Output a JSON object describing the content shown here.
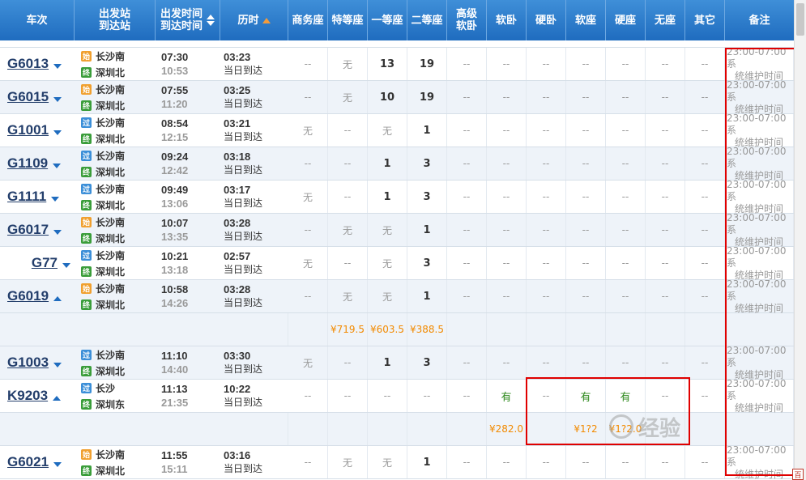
{
  "header": {
    "train_no": "车次",
    "dep_station": "出发站",
    "arr_station": "到达站",
    "dep_time": "出发时间",
    "arr_time": "到达时间",
    "duration": "历时",
    "business": "商务座",
    "special": "特等座",
    "first": "一等座",
    "second": "二等座",
    "adv_soft_1": "高级",
    "adv_soft_2": "软卧",
    "soft_sleeper": "软卧",
    "hard_sleeper": "硬卧",
    "soft_seat": "软座",
    "hard_seat": "硬座",
    "no_seat": "无座",
    "other": "其它",
    "remark": "备注"
  },
  "top_partial": {
    "left": "到达站",
    "mid": "到达时间",
    "right": "当日到达"
  },
  "rows": [
    {
      "train": "G6013",
      "dir": "down",
      "from_badge": "始",
      "from_type": "start",
      "from": "长沙南",
      "to_badge": "终",
      "to_type": "end",
      "to": "深圳北",
      "dep": "07:30",
      "arr": "10:53",
      "dur": "03:23",
      "day": "当日到达",
      "seats": [
        "--",
        "无",
        "13",
        "19",
        "--",
        "--",
        "--",
        "--",
        "--",
        "--",
        "--"
      ],
      "note1": "23:00-07:00系",
      "note2": "统维护时间"
    },
    {
      "train": "G6015",
      "dir": "down",
      "from_badge": "始",
      "from_type": "start",
      "from": "长沙南",
      "to_badge": "终",
      "to_type": "end",
      "to": "深圳北",
      "dep": "07:55",
      "arr": "11:20",
      "dur": "03:25",
      "day": "当日到达",
      "seats": [
        "--",
        "无",
        "10",
        "19",
        "--",
        "--",
        "--",
        "--",
        "--",
        "--",
        "--"
      ],
      "note1": "23:00-07:00系",
      "note2": "统维护时间"
    },
    {
      "train": "G1001",
      "dir": "down",
      "from_badge": "过",
      "from_type": "pass",
      "from": "长沙南",
      "to_badge": "终",
      "to_type": "end",
      "to": "深圳北",
      "dep": "08:54",
      "arr": "12:15",
      "dur": "03:21",
      "day": "当日到达",
      "seats": [
        "无",
        "--",
        "无",
        "1",
        "--",
        "--",
        "--",
        "--",
        "--",
        "--",
        "--"
      ],
      "note1": "23:00-07:00系",
      "note2": "统维护时间"
    },
    {
      "train": "G1109",
      "dir": "down",
      "from_badge": "过",
      "from_type": "pass",
      "from": "长沙南",
      "to_badge": "终",
      "to_type": "end",
      "to": "深圳北",
      "dep": "09:24",
      "arr": "12:42",
      "dur": "03:18",
      "day": "当日到达",
      "seats": [
        "--",
        "--",
        "1",
        "3",
        "--",
        "--",
        "--",
        "--",
        "--",
        "--",
        "--"
      ],
      "note1": "23:00-07:00系",
      "note2": "统维护时间"
    },
    {
      "train": "G1111",
      "dir": "down",
      "from_badge": "过",
      "from_type": "pass",
      "from": "长沙南",
      "to_badge": "终",
      "to_type": "end",
      "to": "深圳北",
      "dep": "09:49",
      "arr": "13:06",
      "dur": "03:17",
      "day": "当日到达",
      "seats": [
        "无",
        "--",
        "1",
        "3",
        "--",
        "--",
        "--",
        "--",
        "--",
        "--",
        "--"
      ],
      "note1": "23:00-07:00系",
      "note2": "统维护时间"
    },
    {
      "train": "G6017",
      "dir": "down",
      "from_badge": "始",
      "from_type": "start",
      "from": "长沙南",
      "to_badge": "终",
      "to_type": "end",
      "to": "深圳北",
      "dep": "10:07",
      "arr": "13:35",
      "dur": "03:28",
      "day": "当日到达",
      "seats": [
        "--",
        "无",
        "无",
        "1",
        "--",
        "--",
        "--",
        "--",
        "--",
        "--",
        "--"
      ],
      "note1": "23:00-07:00系",
      "note2": "统维护时间"
    },
    {
      "train": "G77",
      "dir": "down",
      "from_badge": "过",
      "from_type": "pass",
      "from": "长沙南",
      "to_badge": "终",
      "to_type": "end",
      "to": "深圳北",
      "dep": "10:21",
      "arr": "13:18",
      "dur": "02:57",
      "day": "当日到达",
      "seats": [
        "无",
        "--",
        "无",
        "3",
        "--",
        "--",
        "--",
        "--",
        "--",
        "--",
        "--"
      ],
      "note1": "23:00-07:00系",
      "note2": "统维护时间"
    },
    {
      "train": "G6019",
      "dir": "up",
      "from_badge": "始",
      "from_type": "start",
      "from": "长沙南",
      "to_badge": "终",
      "to_type": "end",
      "to": "深圳北",
      "dep": "10:58",
      "arr": "14:26",
      "dur": "03:28",
      "day": "当日到达",
      "seats": [
        "--",
        "无",
        "无",
        "1",
        "--",
        "--",
        "--",
        "--",
        "--",
        "--",
        "--"
      ],
      "note1": "23:00-07:00系",
      "note2": "统维护时间"
    },
    {
      "price_row": true,
      "prices": [
        "",
        "¥719.5",
        "¥603.5",
        "¥388.5",
        "",
        "",
        "",
        "",
        "",
        "",
        ""
      ]
    },
    {
      "train": "G1003",
      "dir": "down",
      "from_badge": "过",
      "from_type": "pass",
      "from": "长沙南",
      "to_badge": "终",
      "to_type": "end",
      "to": "深圳北",
      "dep": "11:10",
      "arr": "14:40",
      "dur": "03:30",
      "day": "当日到达",
      "seats": [
        "无",
        "--",
        "1",
        "3",
        "--",
        "--",
        "--",
        "--",
        "--",
        "--",
        "--"
      ],
      "note1": "23:00-07:00系",
      "note2": "统维护时间"
    },
    {
      "train": "K9203",
      "dir": "up",
      "from_badge": "过",
      "from_type": "pass",
      "from": "长沙",
      "to_badge": "终",
      "to_type": "end",
      "to": "深圳东",
      "dep": "11:13",
      "arr": "21:35",
      "dur": "10:22",
      "day": "当日到达",
      "seats": [
        "--",
        "--",
        "--",
        "--",
        "--",
        "有",
        "--",
        "有",
        "有",
        "--",
        "--"
      ],
      "note1": "23:00-07:00系",
      "note2": "统维护时间"
    },
    {
      "price_row": true,
      "prices": [
        "",
        "",
        "",
        "",
        "",
        "¥282.0",
        "",
        "¥1?2",
        "¥1?2.0",
        "",
        ""
      ]
    },
    {
      "train": "G6021",
      "dir": "down",
      "from_badge": "始",
      "from_type": "start",
      "from": "长沙南",
      "to_badge": "终",
      "to_type": "end",
      "to": "深圳北",
      "dep": "11:55",
      "arr": "15:11",
      "dur": "03:16",
      "day": "当日到达",
      "seats": [
        "--",
        "无",
        "无",
        "1",
        "--",
        "--",
        "--",
        "--",
        "--",
        "--",
        "--"
      ],
      "note1": "23:00-07:00系",
      "note2": "统维护时间"
    }
  ],
  "watermark_text": "经验",
  "corner_label": "百"
}
